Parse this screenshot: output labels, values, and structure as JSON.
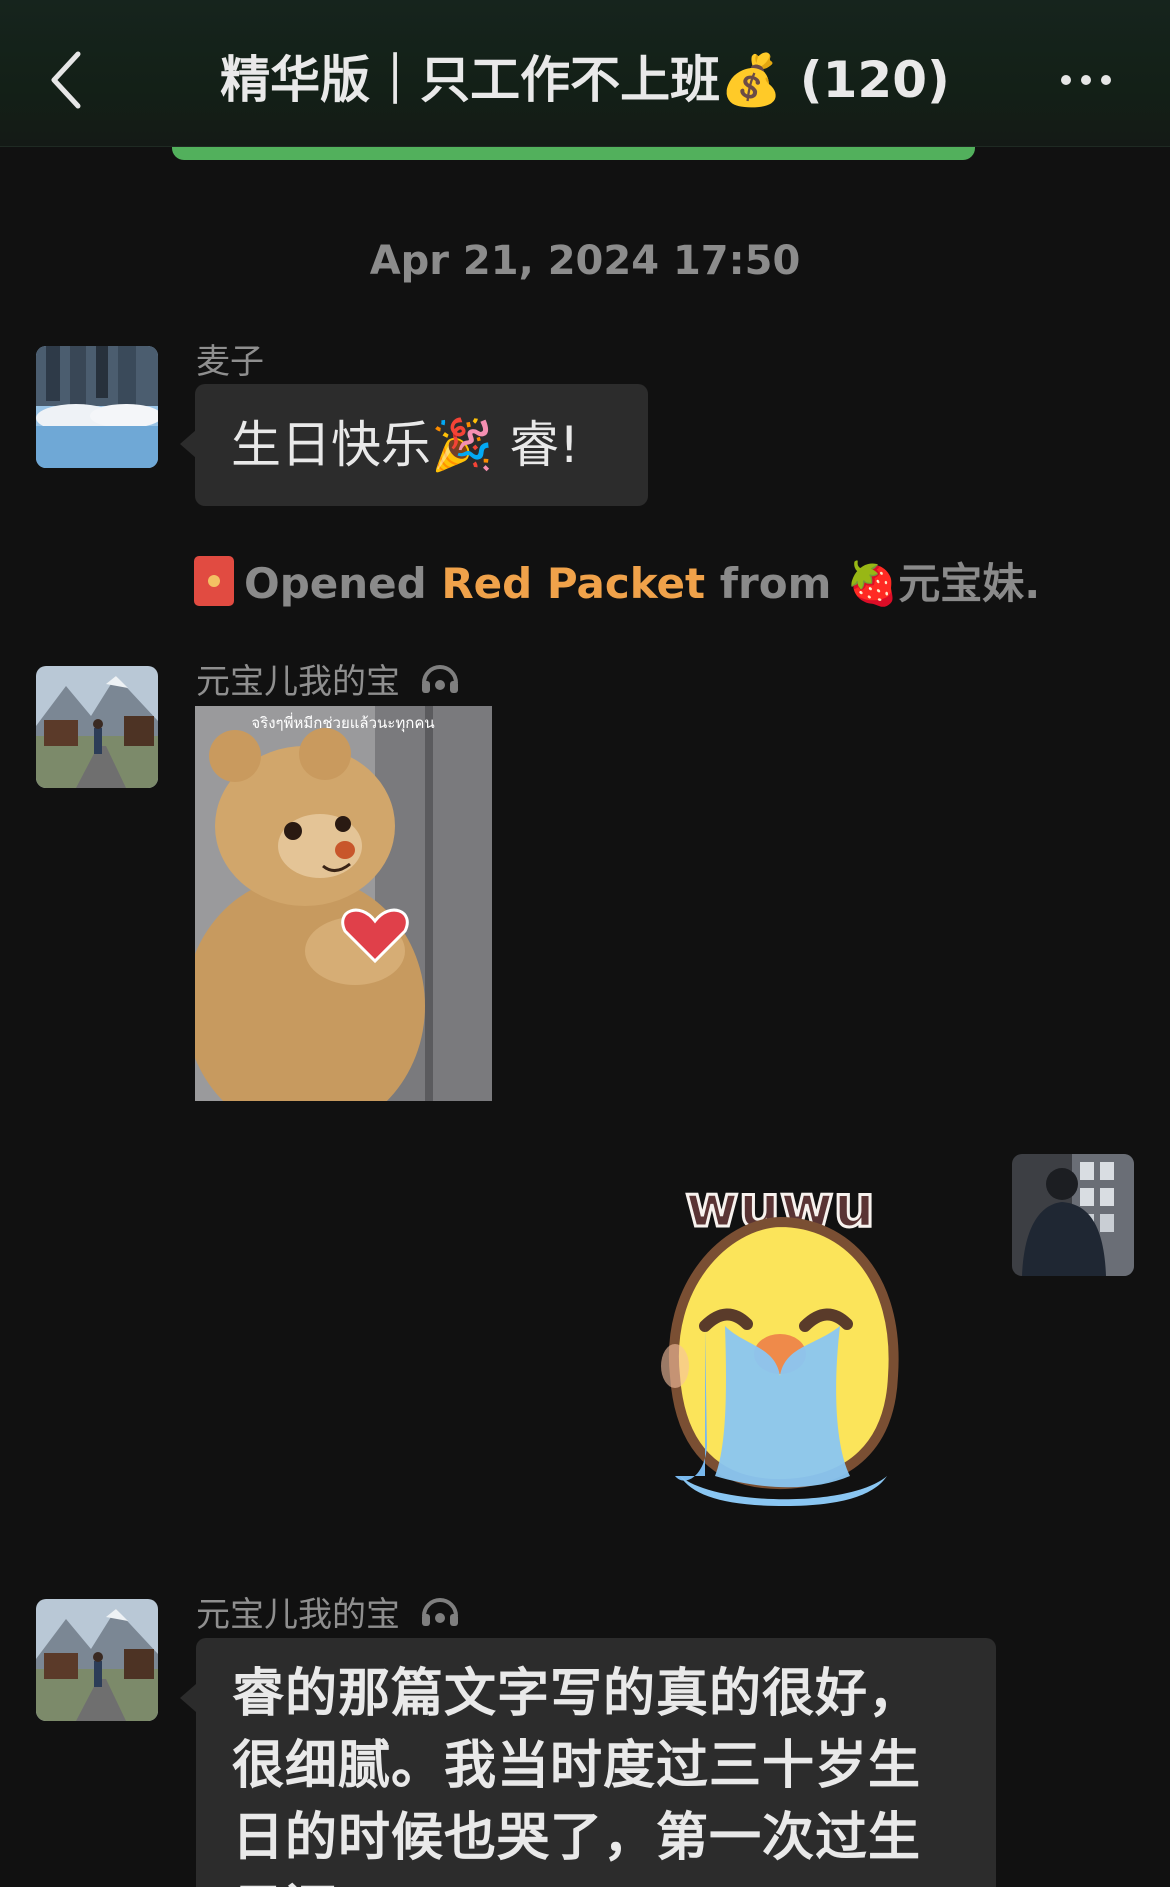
{
  "header": {
    "title": "精华版｜只工作不上班💰 (120)",
    "back_icon": "chevron-left-icon",
    "more_icon": "more-dots-icon"
  },
  "timestamp": "Apr 21, 2024 17:50",
  "messages": [
    {
      "sender": "麦子",
      "text": "生日快乐🎉 睿!"
    },
    {
      "sender": "元宝儿我的宝",
      "sticker_caption": "จริงๆพี่หมีกช่วยแล้วนะทุกคน"
    },
    {
      "sender": "me",
      "sticker_caption": "wuwu"
    },
    {
      "sender": "元宝儿我的宝",
      "text": "睿的那篇文字写的真的很好，很细腻。我当时度过三十岁生日的时候也哭了，第一次过生日还"
    }
  ],
  "system": {
    "prefix": "Opened",
    "highlight": "Red Packet",
    "suffix": "from 🍓元宝妹."
  },
  "colors": {
    "background": "#111111",
    "bubble": "#2c2c2c",
    "accent_green": "#52b05c",
    "red_packet": "#f0a24a"
  }
}
